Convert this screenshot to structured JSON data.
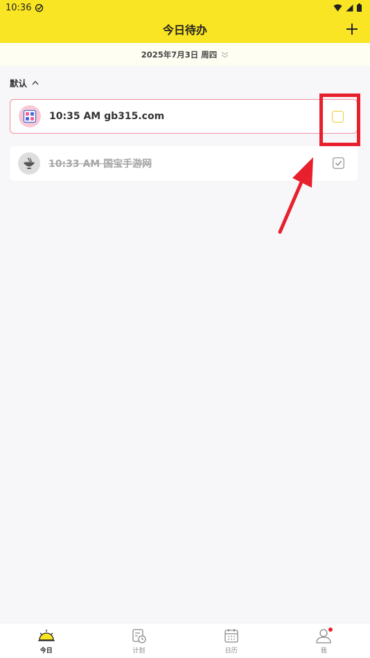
{
  "status_bar": {
    "time": "10:36"
  },
  "header": {
    "title": "今日待办"
  },
  "date_bar": {
    "date": "2025年7月3日 周四"
  },
  "group": {
    "label": "默认"
  },
  "tasks": [
    {
      "time": "10:35 AM",
      "title": "gb315.com",
      "text": "10:35 AM gb315.com",
      "done": false
    },
    {
      "time": "10:33 AM",
      "title": "国宝手游网",
      "text": "10:33 AM 国宝手游网",
      "done": true
    }
  ],
  "bottom_nav": {
    "items": [
      {
        "label": "今日",
        "icon": "sun-icon",
        "active": true
      },
      {
        "label": "计划",
        "icon": "plan-icon",
        "active": false
      },
      {
        "label": "日历",
        "icon": "calendar-icon",
        "active": false
      },
      {
        "label": "我",
        "icon": "profile-icon",
        "active": false,
        "badge": true
      }
    ]
  },
  "colors": {
    "brand_yellow": "#f9e523",
    "highlight_red": "#e8202e",
    "task_border_pink": "#f08fa0",
    "checkbox_yellow": "#f0cc2e"
  }
}
